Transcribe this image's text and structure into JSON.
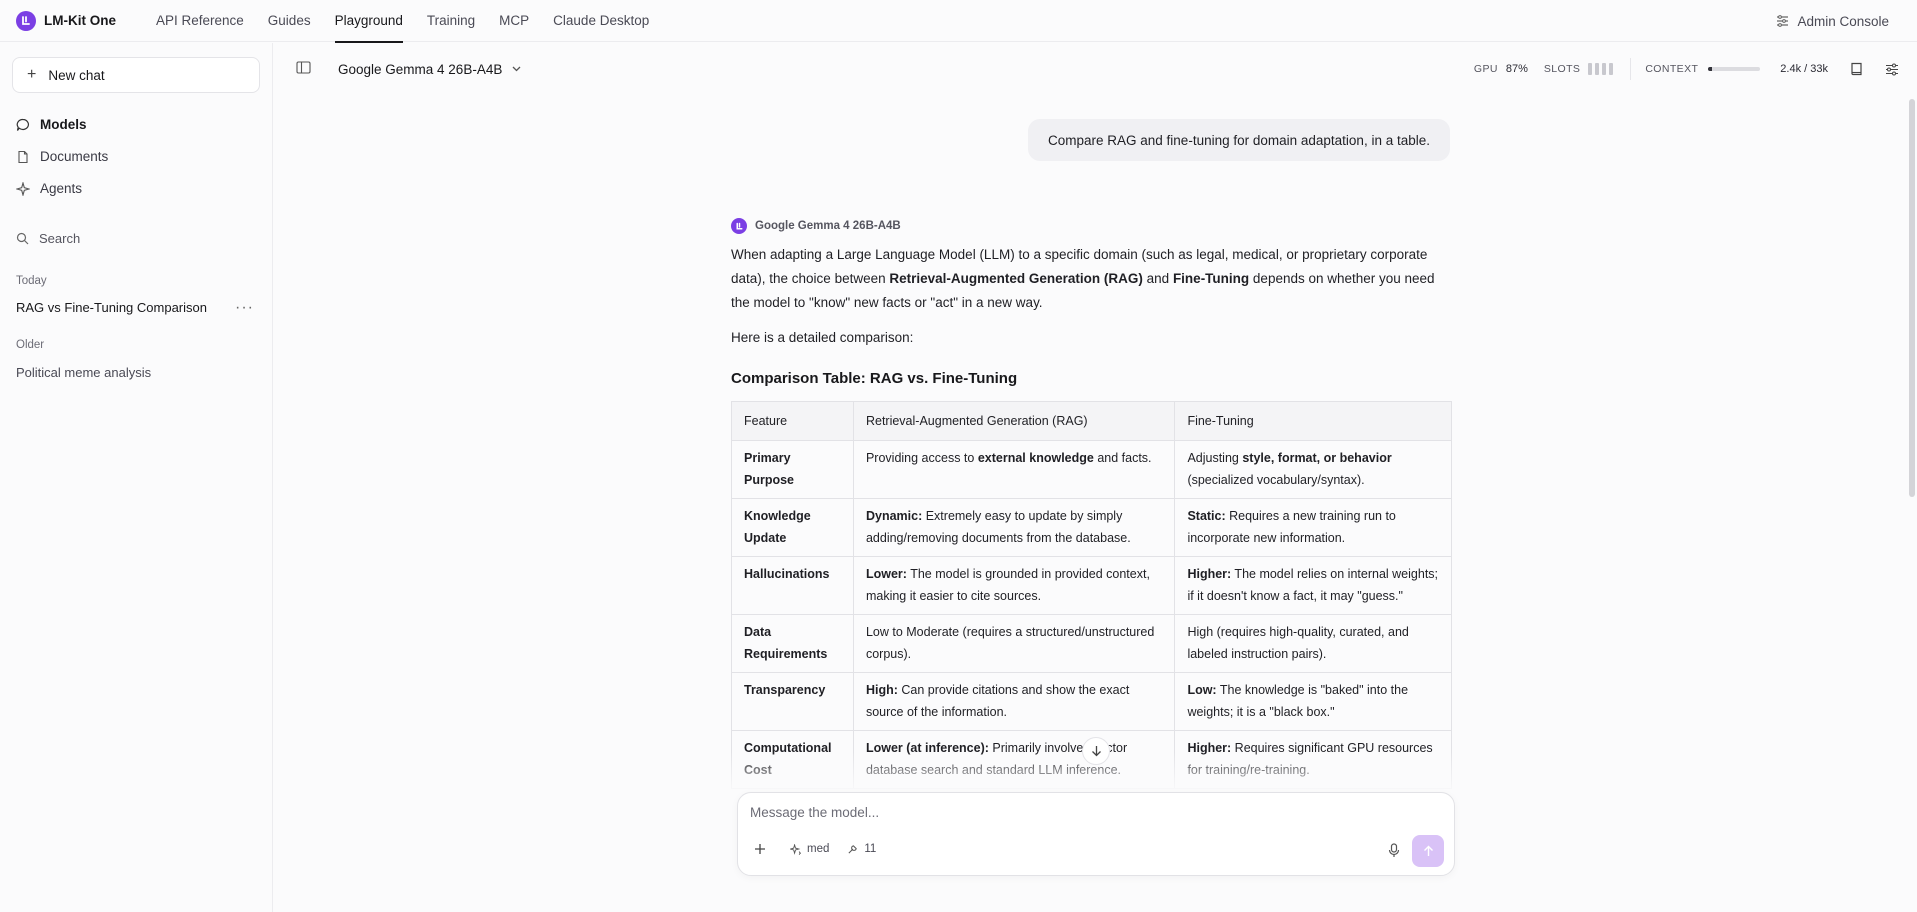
{
  "app": {
    "brand": "LM-Kit One",
    "accent": "#7b3fe4"
  },
  "nav": {
    "links": [
      "API Reference",
      "Guides",
      "Playground",
      "Training",
      "MCP",
      "Claude Desktop"
    ],
    "active": "Playground",
    "admin": "Admin Console"
  },
  "sidebar": {
    "new_chat": "New chat",
    "items": [
      {
        "label": "Models",
        "icon": "chat-bubble-icon",
        "active": true
      },
      {
        "label": "Documents",
        "icon": "document-icon"
      },
      {
        "label": "Agents",
        "icon": "sparkle-icon"
      }
    ],
    "search": "Search",
    "today_label": "Today",
    "today_chat": "RAG vs Fine-Tuning Comparison",
    "older_label": "Older",
    "older_chat": "Political meme analysis",
    "more": "···"
  },
  "header": {
    "model": "Google Gemma 4 26B-A4B",
    "gpu_label": "GPU",
    "gpu_value": "87%",
    "slots_label": "SLOTS",
    "context_label": "CONTEXT",
    "context_value": "2.4k / 33k",
    "context_fraction": 0.073
  },
  "chat": {
    "user_message": "Compare RAG and fine-tuning for domain adaptation, in a table.",
    "assistant_name": "Google Gemma 4 26B-A4B",
    "intro_1": "When adapting a Large Language Model (LLM) to a specific domain (such as legal, medical, or proprietary corporate data), the choice between ",
    "intro_rag": "Retrieval-Augmented Generation (RAG)",
    "intro_and": " and ",
    "intro_ft": "Fine-Tuning",
    "intro_2": " depends on whether you need the model to \"know\" new facts or \"act\" in a new way.",
    "intro_3": "Here is a detailed comparison:",
    "table_title": "Comparison Table: RAG vs. Fine-Tuning",
    "table": {
      "headers": [
        "Feature",
        "Retrieval-Augmented Generation (RAG)",
        "Fine-Tuning"
      ],
      "rows": [
        {
          "feature": "Primary Purpose",
          "rag_pre": "Providing access to ",
          "rag_bold": "external knowledge",
          "rag_post": " and facts.",
          "ft_pre": "Adjusting ",
          "ft_bold": "style, format, or behavior",
          "ft_post": " (specialized vocabulary/syntax)."
        },
        {
          "feature": "Knowledge Update",
          "rag_pre": "",
          "rag_bold": "Dynamic:",
          "rag_post": " Extremely easy to update by simply adding/removing documents from the database.",
          "ft_pre": "",
          "ft_bold": "Static:",
          "ft_post": " Requires a new training run to incorporate new information."
        },
        {
          "feature": "Hallucinations",
          "rag_pre": "",
          "rag_bold": "Lower:",
          "rag_post": " The model is grounded in provided context, making it easier to cite sources.",
          "ft_pre": "",
          "ft_bold": "Higher:",
          "ft_post": " The model relies on internal weights; if it doesn't know a fact, it may \"guess.\""
        },
        {
          "feature": "Data Requirements",
          "rag_pre": "Low to Moderate (requires a structured/unstructured corpus).",
          "rag_bold": "",
          "rag_post": "",
          "ft_pre": "High (requires high-quality, curated, and labeled instruction pairs).",
          "ft_bold": "",
          "ft_post": ""
        },
        {
          "feature": "Transparency",
          "rag_pre": "",
          "rag_bold": "High:",
          "rag_post": " Can provide citations and show the exact source of the information.",
          "ft_pre": "",
          "ft_bold": "Low:",
          "ft_post": " The knowledge is \"baked\" into the weights; it is a \"black box.\""
        },
        {
          "feature": "Computational Cost",
          "rag_pre": "",
          "rag_bold": "Lower (at inference):",
          "rag_post": " Primarily involves vector database search and standard LLM inference.",
          "ft_pre": "",
          "ft_bold": "Higher:",
          "ft_post": " Requires significant GPU resources for training/re-training."
        }
      ]
    }
  },
  "composer": {
    "placeholder": "Message the model...",
    "reasoning": "med",
    "tools_count": "11"
  }
}
